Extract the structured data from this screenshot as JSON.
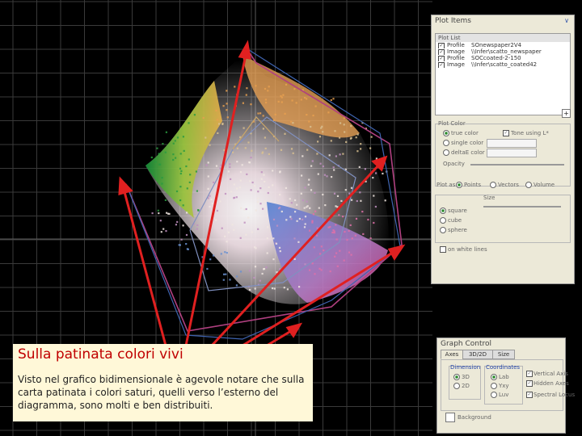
{
  "plot_items": {
    "title": "Plot Items",
    "list_header": "Plot List",
    "rows": [
      {
        "checked": true,
        "type": "Profile",
        "name": "SOnewspaper2V4"
      },
      {
        "checked": true,
        "type": "Image",
        "name": "\\\\Infer\\scatto_newspaper"
      },
      {
        "checked": true,
        "type": "Profile",
        "name": "SOCcoated-2-150"
      },
      {
        "checked": true,
        "type": "Image",
        "name": "\\\\Infer\\scatto_coated42"
      }
    ],
    "plot_color": "Plot Color",
    "true_color": "true color",
    "tone_using": "Tone using L*",
    "single_color": "single color",
    "delta_e": "deltaE color",
    "opacity": "Opacity",
    "plot_as_label": "Plot as",
    "plot_as_options": [
      "Points",
      "Vectors",
      "Volume"
    ],
    "size_label": "Size",
    "shapes": [
      "square",
      "cube",
      "sphere"
    ],
    "on_white": "on white lines"
  },
  "graph_control": {
    "title": "Graph Control",
    "tabs": [
      "Axes",
      "3D/2D",
      "Size"
    ],
    "dimension_label": "Dimension",
    "dimension_options": [
      "3D",
      "2D"
    ],
    "coordinates_label": "Coordinates",
    "coordinates_options": [
      "Lab",
      "Yxy",
      "Luv"
    ],
    "vertical_axis": "Vertical Axis",
    "hidden_axes": "Hidden Axes",
    "spectral_locus": "Spectral Locus",
    "background": "Background"
  },
  "caption": {
    "title": "Sulla patinata colori vivi",
    "body": "Visto nel grafico bidimensionale è agevole notare che sulla carta patinata i colori saturi, quelli verso l’esterno del diagramma, sono molti e ben distribuiti."
  },
  "colors": {
    "arrow": "#e02020",
    "caption_title": "#c00000",
    "caption_bg": "#fff8d8",
    "grid": "#3a3a3a"
  }
}
